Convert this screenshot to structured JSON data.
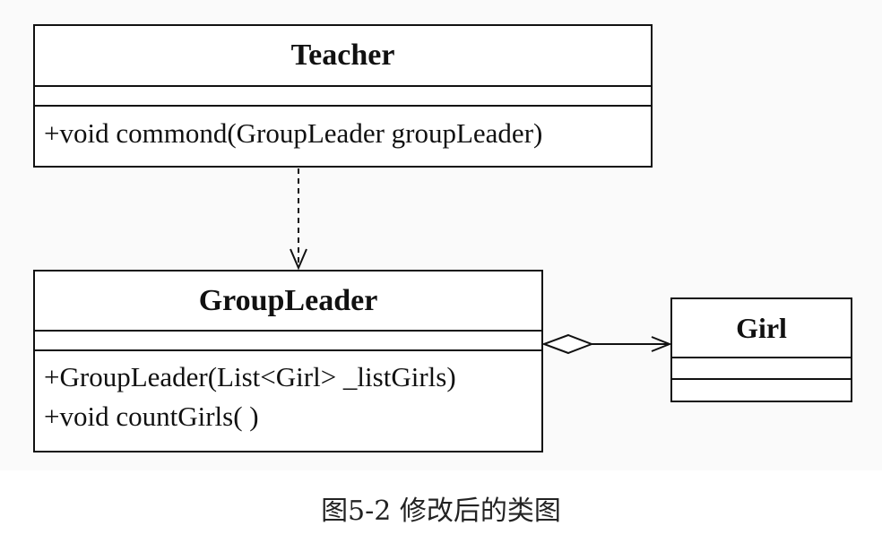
{
  "diagram": {
    "type": "uml-class-diagram",
    "classes": {
      "teacher": {
        "name": "Teacher",
        "attributes": [],
        "operations": [
          "+void commond(GroupLeader groupLeader)"
        ]
      },
      "group_leader": {
        "name": "GroupLeader",
        "attributes": [],
        "operations": [
          "+GroupLeader(List<Girl> _listGirls)",
          "+void countGirls( )"
        ]
      },
      "girl": {
        "name": "Girl",
        "attributes": [],
        "operations": []
      }
    },
    "relationships": [
      {
        "from": "Teacher",
        "to": "GroupLeader",
        "kind": "dependency",
        "style": "dashed-open-arrow"
      },
      {
        "from": "GroupLeader",
        "to": "Girl",
        "kind": "aggregation",
        "style": "hollow-diamond-open-arrow"
      }
    ],
    "line_color": "#111111"
  },
  "caption": "图5-2 修改后的类图"
}
